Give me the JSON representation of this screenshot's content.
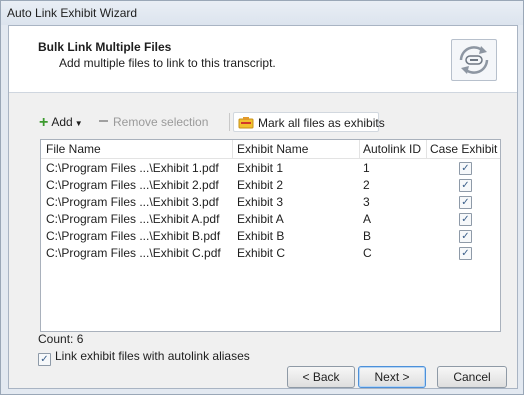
{
  "window": {
    "title": "Auto Link Exhibit Wizard"
  },
  "header": {
    "title": "Bulk Link Multiple Files",
    "subtitle": "Add multiple files to link to this transcript."
  },
  "toolbar": {
    "add_label": "Add",
    "remove_label": "Remove selection",
    "mark_label": "Mark all files as exhibits"
  },
  "table": {
    "columns": [
      "File Name",
      "Exhibit Name",
      "Autolink ID",
      "Case Exhibit"
    ],
    "rows": [
      {
        "file": "C:\\Program Files ...\\Exhibit 1.pdf",
        "exhibit": "Exhibit 1",
        "autolink": "1",
        "case_exhibit": true
      },
      {
        "file": "C:\\Program Files ...\\Exhibit 2.pdf",
        "exhibit": "Exhibit 2",
        "autolink": "2",
        "case_exhibit": true
      },
      {
        "file": "C:\\Program Files ...\\Exhibit 3.pdf",
        "exhibit": "Exhibit 3",
        "autolink": "3",
        "case_exhibit": true
      },
      {
        "file": "C:\\Program Files ...\\Exhibit A.pdf",
        "exhibit": "Exhibit A",
        "autolink": "A",
        "case_exhibit": true
      },
      {
        "file": "C:\\Program Files ...\\Exhibit B.pdf",
        "exhibit": "Exhibit B",
        "autolink": "B",
        "case_exhibit": true
      },
      {
        "file": "C:\\Program Files ...\\Exhibit C.pdf",
        "exhibit": "Exhibit C",
        "autolink": "C",
        "case_exhibit": true
      }
    ]
  },
  "count_label": "Count: 6",
  "link_option": {
    "label": "Link exhibit files with autolink aliases",
    "checked": true
  },
  "buttons": {
    "back": "< Back",
    "next": "Next >",
    "cancel": "Cancel"
  },
  "icons": {
    "add": "plus-icon",
    "remove": "minus-icon",
    "mark": "exhibit-stamp-icon",
    "wizard": "link-cycle-icon",
    "checkbox": "check-icon"
  },
  "colors": {
    "accent_green": "#3c9a2e",
    "default_button_border": "#4d90d9"
  }
}
